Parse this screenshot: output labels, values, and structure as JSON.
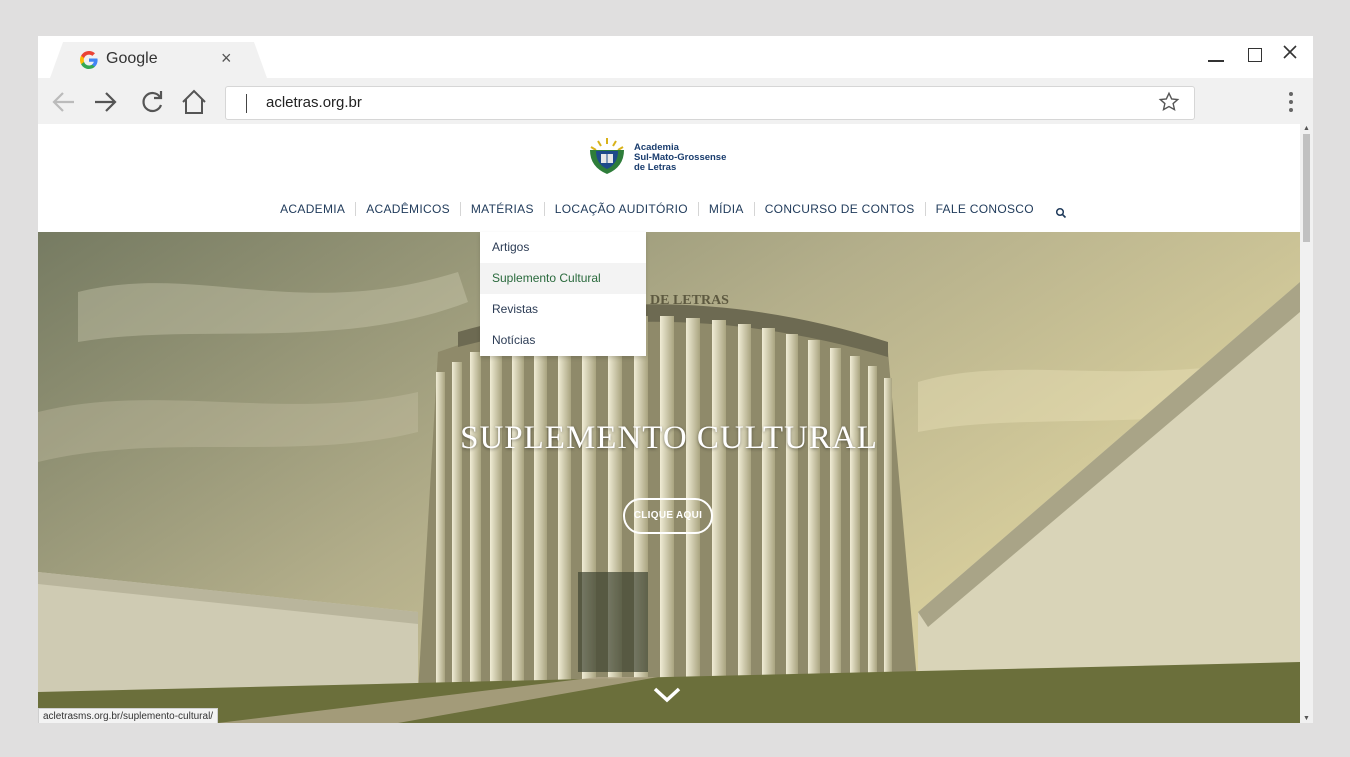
{
  "browser": {
    "tab_title": "Google",
    "tab_close": "×",
    "url": "acletras.org.br",
    "status_url": "acletrasms.org.br/suplemento-cultural/"
  },
  "site": {
    "logo_lines": [
      "Academia",
      "Sul-Mato-Grossense",
      "de Letras"
    ],
    "nav": [
      "ACADEMIA",
      "ACADÊMICOS",
      "MATÉRIAS",
      "LOCAÇÃO AUDITÓRIO",
      "MÍDIA",
      "CONCURSO DE CONTOS",
      "FALE CONOSCO"
    ],
    "dropdown": [
      "Artigos",
      "Suplemento Cultural",
      "Revistas",
      "Notícias"
    ],
    "hero_title": "SUPLEMENTO CULTURAL",
    "hero_button": "CLIQUE AQUI",
    "building_sign": "DE LETRAS"
  },
  "colors": {
    "nav_text": "#1f3a5a",
    "dropdown_active": "#2a6a3d"
  }
}
